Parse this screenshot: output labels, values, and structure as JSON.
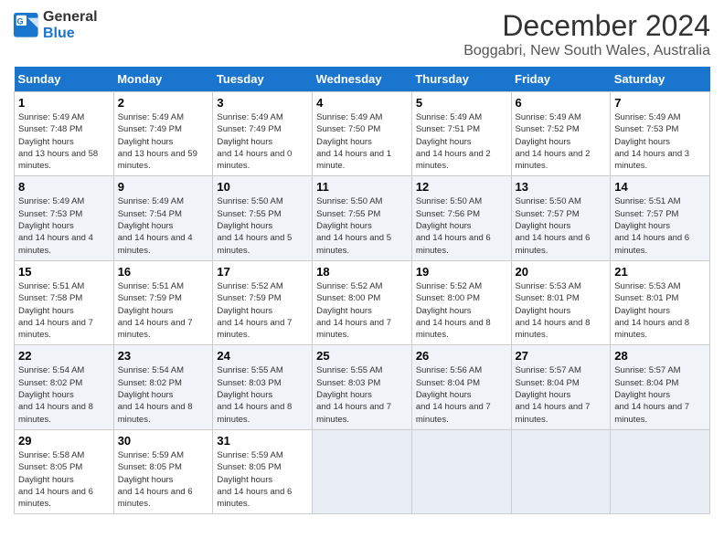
{
  "logo": {
    "line1": "General",
    "line2": "Blue"
  },
  "title": "December 2024",
  "subtitle": "Boggabri, New South Wales, Australia",
  "days_of_week": [
    "Sunday",
    "Monday",
    "Tuesday",
    "Wednesday",
    "Thursday",
    "Friday",
    "Saturday"
  ],
  "weeks": [
    [
      {
        "day": "1",
        "sunrise": "5:49 AM",
        "sunset": "7:48 PM",
        "daylight": "13 hours and 58 minutes."
      },
      {
        "day": "2",
        "sunrise": "5:49 AM",
        "sunset": "7:49 PM",
        "daylight": "13 hours and 59 minutes."
      },
      {
        "day": "3",
        "sunrise": "5:49 AM",
        "sunset": "7:49 PM",
        "daylight": "14 hours and 0 minutes."
      },
      {
        "day": "4",
        "sunrise": "5:49 AM",
        "sunset": "7:50 PM",
        "daylight": "14 hours and 1 minute."
      },
      {
        "day": "5",
        "sunrise": "5:49 AM",
        "sunset": "7:51 PM",
        "daylight": "14 hours and 2 minutes."
      },
      {
        "day": "6",
        "sunrise": "5:49 AM",
        "sunset": "7:52 PM",
        "daylight": "14 hours and 2 minutes."
      },
      {
        "day": "7",
        "sunrise": "5:49 AM",
        "sunset": "7:53 PM",
        "daylight": "14 hours and 3 minutes."
      }
    ],
    [
      {
        "day": "8",
        "sunrise": "5:49 AM",
        "sunset": "7:53 PM",
        "daylight": "14 hours and 4 minutes."
      },
      {
        "day": "9",
        "sunrise": "5:49 AM",
        "sunset": "7:54 PM",
        "daylight": "14 hours and 4 minutes."
      },
      {
        "day": "10",
        "sunrise": "5:50 AM",
        "sunset": "7:55 PM",
        "daylight": "14 hours and 5 minutes."
      },
      {
        "day": "11",
        "sunrise": "5:50 AM",
        "sunset": "7:55 PM",
        "daylight": "14 hours and 5 minutes."
      },
      {
        "day": "12",
        "sunrise": "5:50 AM",
        "sunset": "7:56 PM",
        "daylight": "14 hours and 6 minutes."
      },
      {
        "day": "13",
        "sunrise": "5:50 AM",
        "sunset": "7:57 PM",
        "daylight": "14 hours and 6 minutes."
      },
      {
        "day": "14",
        "sunrise": "5:51 AM",
        "sunset": "7:57 PM",
        "daylight": "14 hours and 6 minutes."
      }
    ],
    [
      {
        "day": "15",
        "sunrise": "5:51 AM",
        "sunset": "7:58 PM",
        "daylight": "14 hours and 7 minutes."
      },
      {
        "day": "16",
        "sunrise": "5:51 AM",
        "sunset": "7:59 PM",
        "daylight": "14 hours and 7 minutes."
      },
      {
        "day": "17",
        "sunrise": "5:52 AM",
        "sunset": "7:59 PM",
        "daylight": "14 hours and 7 minutes."
      },
      {
        "day": "18",
        "sunrise": "5:52 AM",
        "sunset": "8:00 PM",
        "daylight": "14 hours and 7 minutes."
      },
      {
        "day": "19",
        "sunrise": "5:52 AM",
        "sunset": "8:00 PM",
        "daylight": "14 hours and 8 minutes."
      },
      {
        "day": "20",
        "sunrise": "5:53 AM",
        "sunset": "8:01 PM",
        "daylight": "14 hours and 8 minutes."
      },
      {
        "day": "21",
        "sunrise": "5:53 AM",
        "sunset": "8:01 PM",
        "daylight": "14 hours and 8 minutes."
      }
    ],
    [
      {
        "day": "22",
        "sunrise": "5:54 AM",
        "sunset": "8:02 PM",
        "daylight": "14 hours and 8 minutes."
      },
      {
        "day": "23",
        "sunrise": "5:54 AM",
        "sunset": "8:02 PM",
        "daylight": "14 hours and 8 minutes."
      },
      {
        "day": "24",
        "sunrise": "5:55 AM",
        "sunset": "8:03 PM",
        "daylight": "14 hours and 8 minutes."
      },
      {
        "day": "25",
        "sunrise": "5:55 AM",
        "sunset": "8:03 PM",
        "daylight": "14 hours and 7 minutes."
      },
      {
        "day": "26",
        "sunrise": "5:56 AM",
        "sunset": "8:04 PM",
        "daylight": "14 hours and 7 minutes."
      },
      {
        "day": "27",
        "sunrise": "5:57 AM",
        "sunset": "8:04 PM",
        "daylight": "14 hours and 7 minutes."
      },
      {
        "day": "28",
        "sunrise": "5:57 AM",
        "sunset": "8:04 PM",
        "daylight": "14 hours and 7 minutes."
      }
    ],
    [
      {
        "day": "29",
        "sunrise": "5:58 AM",
        "sunset": "8:05 PM",
        "daylight": "14 hours and 6 minutes."
      },
      {
        "day": "30",
        "sunrise": "5:59 AM",
        "sunset": "8:05 PM",
        "daylight": "14 hours and 6 minutes."
      },
      {
        "day": "31",
        "sunrise": "5:59 AM",
        "sunset": "8:05 PM",
        "daylight": "14 hours and 6 minutes."
      },
      null,
      null,
      null,
      null
    ]
  ]
}
